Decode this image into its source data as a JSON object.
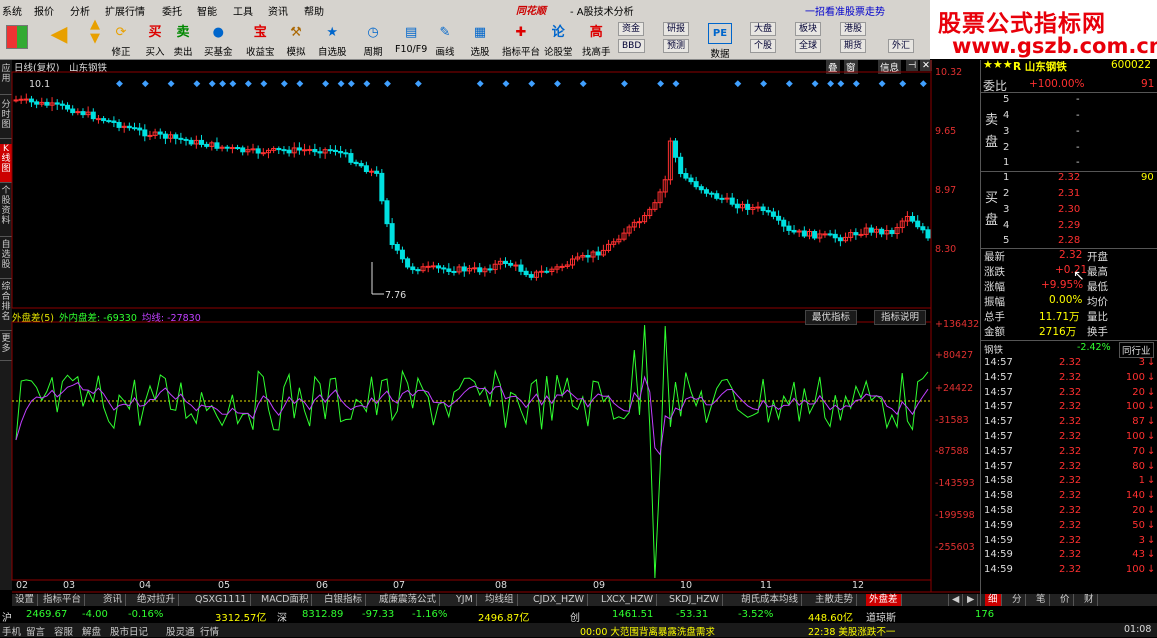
{
  "menu": [
    "系统",
    "报价",
    "分析",
    "扩展行情",
    "委托",
    "智能",
    "工具",
    "资讯",
    "帮助"
  ],
  "app": {
    "logo": "同花顺",
    "title": "- A股技术分析",
    "slogan": "一招看准股票走势"
  },
  "banner": {
    "line1": "股票公式指标网",
    "line2": "www.gszb.com.cn"
  },
  "toolbar": [
    {
      "name": "buy",
      "label": "买入",
      "icon": "买"
    },
    {
      "name": "sell",
      "label": "卖出",
      "icon": "卖"
    },
    {
      "name": "buy-fund",
      "label": "买基金",
      "icon": "●"
    },
    {
      "name": "income",
      "label": "收益宝",
      "icon": "宝"
    },
    {
      "name": "simulate",
      "label": "模拟",
      "icon": "⚒"
    },
    {
      "name": "watchlist",
      "label": "自选股",
      "icon": "★"
    },
    {
      "name": "period",
      "label": "周期",
      "icon": "◷"
    },
    {
      "name": "f10",
      "label": "F10/F9",
      "icon": "▤"
    },
    {
      "name": "draw",
      "label": "画线",
      "icon": "✎"
    },
    {
      "name": "select",
      "label": "选股",
      "icon": "▦"
    },
    {
      "name": "indicator-platform",
      "label": "指标平台",
      "icon": "✚"
    },
    {
      "name": "forum",
      "label": "论股堂",
      "icon": "论"
    },
    {
      "name": "expert",
      "label": "找高手",
      "icon": "高"
    },
    {
      "name": "data",
      "label": "数据",
      "icon": "PE"
    }
  ],
  "toolbar_left": {
    "refresh": "修正",
    "back": "后退"
  },
  "toolbar_small": [
    "资金",
    "研报",
    "大盘",
    "板块",
    "港股",
    "BBD",
    "预测",
    "个股",
    "全球",
    "期货",
    "外汇"
  ],
  "left_tabs": [
    "应用",
    "分时图",
    "K线图",
    "个股资料",
    "自选股",
    "综合排名",
    "更多"
  ],
  "chart": {
    "title": "日线(复权)",
    "stock": "山东钢铁",
    "buttons": [
      "叠",
      "窗",
      "信息"
    ],
    "price_labels": [
      "10.32",
      "9.65",
      "8.97",
      "8.30"
    ],
    "high_label": "10.1",
    "low_label": "7.76",
    "months": [
      "02",
      "03",
      "04",
      "05",
      "06",
      "07",
      "08",
      "09",
      "10",
      "11",
      "12"
    ],
    "ind_labels": [
      "+136432",
      "+80427",
      "+24422",
      "-31583",
      "-87588",
      "-143593",
      "-199598",
      "-255603"
    ]
  },
  "indicator": {
    "name": "外盘差(5)",
    "line1": "外内盘差: -69330",
    "line2": "均线: -27830",
    "btn1": "最优指标",
    "btn2": "指标说明"
  },
  "bottom_tabs": [
    "设置",
    "指标平台",
    "资讯",
    "绝对拉升",
    "QSXG1111",
    "MACD面积",
    "白银指标",
    "威廉震荡公式",
    "YJM",
    "均线组",
    "CJDX_HZW",
    "LXCX_HZW",
    "SKDJ_HZW",
    "胡氏成本均线",
    "主散走势",
    "外盘差"
  ],
  "status": {
    "sh_label": "沪",
    "sh": "2469.67",
    "sh_chg": "-4.00",
    "sh_pct": "-0.16%",
    "sh_amt": "3312.57亿",
    "sz_label": "深",
    "sz": "8312.89",
    "sz_chg": "-97.33",
    "sz_pct": "-1.16%",
    "sz_amt": "2496.87亿",
    "cy_label": "创",
    "cy": "1461.51",
    "cy_chg": "-53.31",
    "cy_pct": "-3.52%",
    "cy_amt": "448.60亿",
    "dj_label": "道琼斯",
    "dj": "176"
  },
  "footer": {
    "items": [
      "手机",
      "留言",
      "容服",
      "解盘",
      "股市日记",
      "股灵通",
      "行情"
    ],
    "news1": "00:00 大范围背离暴露洗盘需求",
    "news2": "22:38 美股涨跌不一",
    "time": "01:08"
  },
  "quote": {
    "name": "R 山东钢铁",
    "code": "600022",
    "weibi_label": "委比",
    "weibi": "+100.00%",
    "weicha": "91",
    "sell_label": "卖盘",
    "buy_label": "买盘",
    "sells": [
      {
        "lv": "5",
        "p": "-"
      },
      {
        "lv": "4",
        "p": "-"
      },
      {
        "lv": "3",
        "p": "-"
      },
      {
        "lv": "2",
        "p": "-"
      },
      {
        "lv": "1",
        "p": "-"
      }
    ],
    "buys": [
      {
        "lv": "1",
        "p": "2.32",
        "v": "90"
      },
      {
        "lv": "2",
        "p": "2.31",
        "v": ""
      },
      {
        "lv": "3",
        "p": "2.30",
        "v": ""
      },
      {
        "lv": "4",
        "p": "2.29",
        "v": ""
      },
      {
        "lv": "5",
        "p": "2.28",
        "v": ""
      }
    ],
    "info": [
      {
        "l": "最新",
        "v": "2.32",
        "l2": "开盘"
      },
      {
        "l": "涨跌",
        "v": "+0.21",
        "l2": "最高"
      },
      {
        "l": "涨幅",
        "v": "+9.95%",
        "l2": "最低"
      },
      {
        "l": "振幅",
        "v": "0.00%",
        "l2": "均价"
      },
      {
        "l": "总手",
        "v": "11.71万",
        "l2": "量比"
      },
      {
        "l": "金额",
        "v": "2716万",
        "l2": "换手"
      }
    ],
    "sector": "钢铁",
    "sector_pct": "-2.42%",
    "sector_btn": "同行业",
    "ticks": [
      {
        "t": "14:57",
        "p": "2.32",
        "v": "3"
      },
      {
        "t": "14:57",
        "p": "2.32",
        "v": "100"
      },
      {
        "t": "14:57",
        "p": "2.32",
        "v": "20"
      },
      {
        "t": "14:57",
        "p": "2.32",
        "v": "100"
      },
      {
        "t": "14:57",
        "p": "2.32",
        "v": "87"
      },
      {
        "t": "14:57",
        "p": "2.32",
        "v": "100"
      },
      {
        "t": "14:57",
        "p": "2.32",
        "v": "70"
      },
      {
        "t": "14:57",
        "p": "2.32",
        "v": "80"
      },
      {
        "t": "14:58",
        "p": "2.32",
        "v": "1"
      },
      {
        "t": "14:58",
        "p": "2.32",
        "v": "140"
      },
      {
        "t": "14:58",
        "p": "2.32",
        "v": "20"
      },
      {
        "t": "14:59",
        "p": "2.32",
        "v": "50"
      },
      {
        "t": "14:59",
        "p": "2.32",
        "v": "3"
      },
      {
        "t": "14:59",
        "p": "2.32",
        "v": "43"
      },
      {
        "t": "14:59",
        "p": "2.32",
        "v": "100"
      }
    ],
    "bottom_tabs": [
      "细",
      "分",
      "笔",
      "价",
      "财"
    ]
  },
  "colors": {
    "up": "#ff3030",
    "down": "#00e0e0",
    "green": "#00ff00",
    "yellow": "#ffff00",
    "purple": "#c040ff",
    "bg": "#000000"
  }
}
